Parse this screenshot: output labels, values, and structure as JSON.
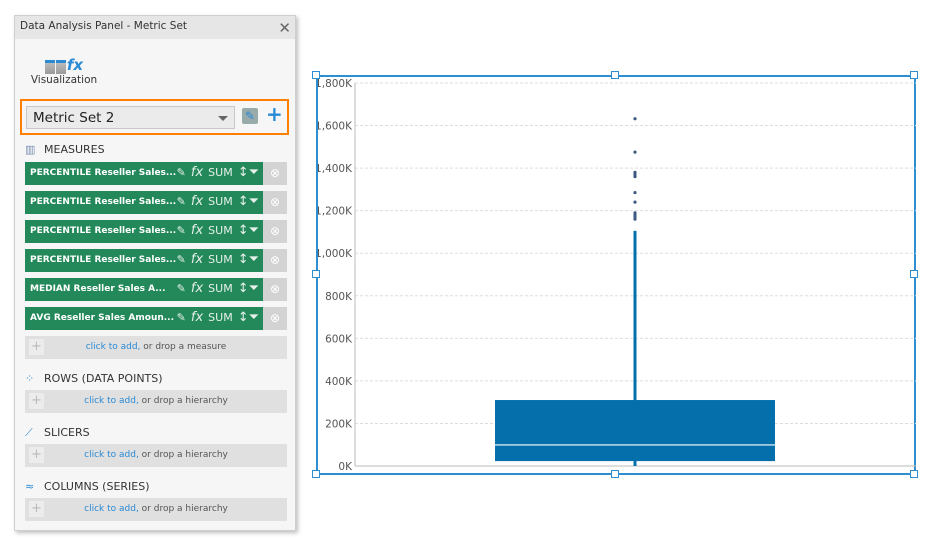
{
  "panel": {
    "title": "Data Analysis Panel - Metric Set",
    "close_icon": "close-icon",
    "visualization_label": "Visualization",
    "metric_set": "Metric Set 2",
    "accent": "#2a8ad4",
    "highlight": "#ff7f00",
    "sections": {
      "measures": "MEASURES",
      "rows": "ROWS (DATA POINTS)",
      "slicers": "SLICERS",
      "columns": "COLUMNS (SERIES)"
    },
    "measures": [
      {
        "label": "PERCENTILE Reseller Sales...",
        "agg": "SUM"
      },
      {
        "label": "PERCENTILE Reseller Sales...",
        "agg": "SUM"
      },
      {
        "label": "PERCENTILE Reseller Sales...",
        "agg": "SUM"
      },
      {
        "label": "PERCENTILE Reseller Sales...",
        "agg": "SUM"
      },
      {
        "label": "MEDIAN Reseller Sales A...",
        "agg": "SUM"
      },
      {
        "label": "AVG Reseller Sales Amoun...",
        "agg": "SUM"
      }
    ],
    "measure_color": "#23895a",
    "fx_label": "fx",
    "add_link": "click to add,",
    "add_measure_rest": " or drop a measure",
    "add_hierarchy_rest": " or drop a hierarchy"
  },
  "chart_data": {
    "type": "boxplot",
    "ylim": [
      0,
      1800000
    ],
    "yticks": [
      "0K",
      "200K",
      "400K",
      "600K",
      "800K",
      "1,000K",
      "1,200K",
      "1,400K",
      "1,600K",
      "1,800K"
    ],
    "grid": true,
    "color": "#056fab",
    "box": {
      "min": 0,
      "q1": 23000,
      "median": 99000,
      "q3": 310000,
      "max": 1105000
    },
    "outliers": [
      1632000,
      1475000,
      1380000,
      1370000,
      1360000,
      1285000,
      1240000,
      1190000,
      1180000,
      1170000,
      1160000
    ]
  }
}
